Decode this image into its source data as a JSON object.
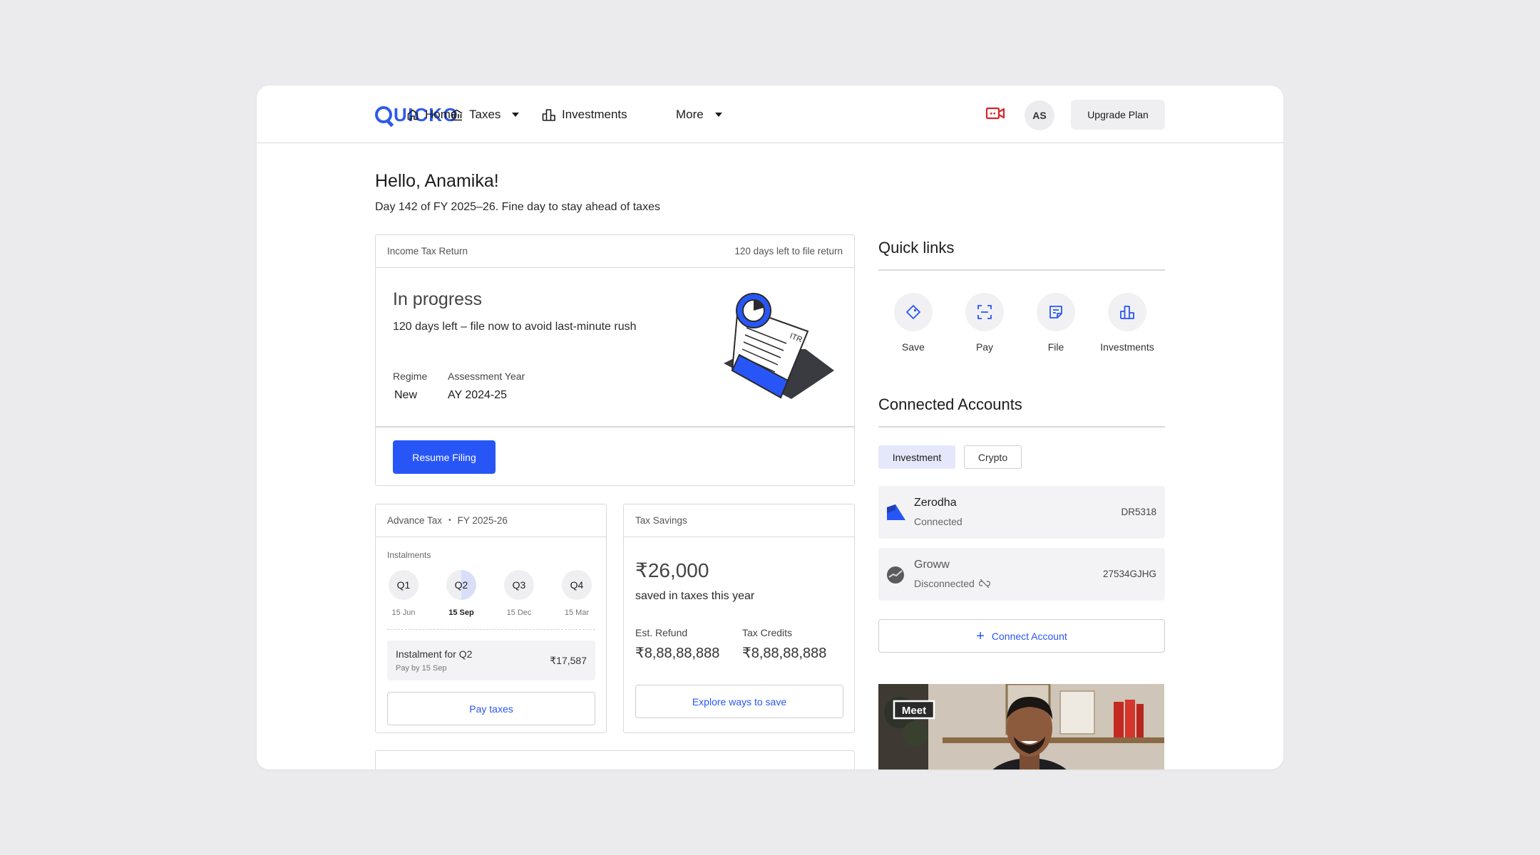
{
  "nav": {
    "logo": "QUICKO",
    "logo_rest": "UICKO",
    "items": [
      {
        "label": "Home",
        "icon": "home-icon"
      },
      {
        "label": "Taxes",
        "icon": "bank-icon"
      },
      {
        "label": "Investments",
        "icon": "bar-chart-icon"
      },
      {
        "label": "More"
      }
    ],
    "avatar_initials": "AS",
    "upgrade_label": "Upgrade Plan",
    "meet_icon": "video-call-icon"
  },
  "greeting": {
    "title": "Hello, Anamika!",
    "subtitle": "Day 142 of FY 2025–26. Fine day to stay ahead of taxes"
  },
  "itr": {
    "header": "Income Tax Return",
    "deadline": "120 days left to file return",
    "status": "In progress",
    "description": "120 days left – file now to avoid last-minute rush",
    "regime_label": "Regime",
    "regime_value": "New",
    "ay_label": "Assessment Year",
    "ay_value": "AY 2024-25",
    "button": "Resume Filing",
    "illustration_text": "ITR"
  },
  "advance_tax": {
    "header": "Advance Tax",
    "fy": "FY 2025-26",
    "subheader": "Instalments",
    "instalments": [
      {
        "label": "Q1",
        "date": "15 Jun",
        "progress": 0.0
      },
      {
        "label": "Q2",
        "date": "15 Sep",
        "progress": 0.5,
        "active": true
      },
      {
        "label": "Q3",
        "date": "15 Dec",
        "progress": 0.0
      },
      {
        "label": "Q4",
        "date": "15 Mar",
        "progress": 0.0
      }
    ],
    "current_title": "Instalment for Q2",
    "current_due": "Pay by 15 Sep",
    "current_amount": "₹17,587",
    "button": "Pay taxes"
  },
  "tax_savings": {
    "header": "Tax Savings",
    "amount": "₹26,000",
    "description": "saved in taxes this year",
    "refund_label": "Est. Refund",
    "refund_value": "₹8,88,88,888",
    "credits_label": "Tax Credits",
    "credits_value": "₹8,88,88,888",
    "button": "Explore ways to save"
  },
  "quick_links": {
    "title": "Quick links",
    "items": [
      {
        "label": "Save",
        "icon": "tag-icon"
      },
      {
        "label": "Pay",
        "icon": "scan-icon"
      },
      {
        "label": "File",
        "icon": "document-icon"
      },
      {
        "label": "Investments",
        "icon": "bar-chart-icon"
      }
    ]
  },
  "connected_accounts": {
    "title": "Connected Accounts",
    "tabs": [
      "Investment",
      "Crypto"
    ],
    "accounts": [
      {
        "name": "Zerodha",
        "status": "Connected",
        "id": "DR5318"
      },
      {
        "name": "Groww",
        "status": "Disconnected",
        "id": "27534GJHG"
      }
    ],
    "connect_button": "Connect Account"
  },
  "meet_card": {
    "badge": "Meet"
  },
  "colors": {
    "accent": "#2856f6",
    "logo": "#2f5bea",
    "meet_icon": "#d7262a"
  }
}
